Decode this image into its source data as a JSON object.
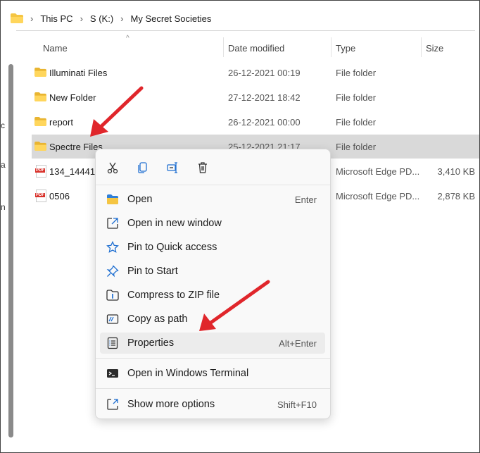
{
  "breadcrumb": [
    "This PC",
    "S (K:)",
    "My Secret Societies"
  ],
  "left_fragments": [
    "c",
    "a",
    "n"
  ],
  "columns": {
    "name": "Name",
    "date": "Date modified",
    "type": "Type",
    "size": "Size"
  },
  "rows": [
    {
      "name": "Illuminati Files",
      "date": "26-12-2021 00:19",
      "type": "File folder",
      "size": "",
      "icon": "folder-icon"
    },
    {
      "name": "New Folder",
      "date": "27-12-2021 18:42",
      "type": "File folder",
      "size": "",
      "icon": "folder-icon"
    },
    {
      "name": "report",
      "date": "26-12-2021 00:00",
      "type": "File folder",
      "size": "",
      "icon": "folder-icon"
    },
    {
      "name": "Spectre Files",
      "date": "25-12-2021 21:17",
      "type": "File folder",
      "size": "",
      "icon": "folder-icon",
      "selected": true
    },
    {
      "name": "134_144410",
      "date": "",
      "type": "Microsoft Edge PD...",
      "size": "3,410 KB",
      "icon": "pdf-icon"
    },
    {
      "name": "0506",
      "date": "",
      "type": "Microsoft Edge PD...",
      "size": "2,878 KB",
      "icon": "pdf-icon"
    }
  ],
  "context_menu": {
    "quick_actions": [
      "cut-icon",
      "copy-icon",
      "rename-icon",
      "delete-icon"
    ],
    "items": [
      {
        "label": "Open",
        "shortcut": "Enter",
        "icon": "open-icon"
      },
      {
        "label": "Open in new window",
        "shortcut": "",
        "icon": "new-window-icon"
      },
      {
        "label": "Pin to Quick access",
        "shortcut": "",
        "icon": "star-icon"
      },
      {
        "label": "Pin to Start",
        "shortcut": "",
        "icon": "pin-icon"
      },
      {
        "label": "Compress to ZIP file",
        "shortcut": "",
        "icon": "zip-icon"
      },
      {
        "label": "Copy as path",
        "shortcut": "",
        "icon": "copy-path-icon"
      },
      {
        "label": "Properties",
        "shortcut": "Alt+Enter",
        "icon": "properties-icon",
        "hover": true
      },
      {
        "label": "Open in Windows Terminal",
        "shortcut": "",
        "icon": "terminal-icon"
      },
      {
        "label": "Show more options",
        "shortcut": "Shift+F10",
        "icon": "more-options-icon"
      }
    ]
  },
  "colors": {
    "accent": "#0067c0",
    "folder": "#f5c542",
    "arrow": "#e0262b",
    "selected_row": "#d9d9d9"
  }
}
